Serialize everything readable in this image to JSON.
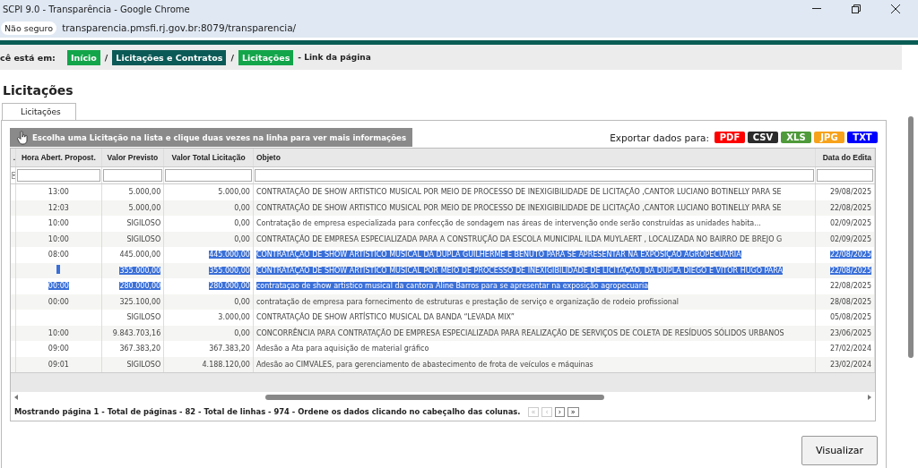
{
  "window": {
    "title": "SCPI 9.0 - Transparência - Google Chrome"
  },
  "address_bar": {
    "security": "Não seguro",
    "url": "transparencia.pmsfi.rj.gov.br:8079/transparencia/"
  },
  "breadcrumb": {
    "label": "cê está em:",
    "items": [
      {
        "text": "Início",
        "kind": "link"
      },
      {
        "text": "Licitações e Contratos",
        "kind": "section"
      },
      {
        "text": "Licitações",
        "kind": "link"
      }
    ],
    "separator": "/",
    "note": "- Link da página"
  },
  "heading": "Licitações",
  "tabs": [
    {
      "label": "Licitações",
      "selected": true
    }
  ],
  "hint": "Escolha uma Licitação na lista e clique duas vezes na linha para ver mais informações",
  "export": {
    "label": "Exportar dados para:",
    "buttons": [
      {
        "label": "PDF",
        "color": "#ff0000"
      },
      {
        "label": "CSV",
        "color": "#2b2b2b"
      },
      {
        "label": "XLS",
        "color": "#4f9a3a"
      },
      {
        "label": "JPG",
        "color": "#f7a21b"
      },
      {
        "label": "TXT",
        "color": "#0000ff"
      }
    ]
  },
  "table": {
    "cut_column": ".",
    "columns": [
      "Hora Abert. Propost.",
      "Valor Previsto",
      "Valor Total Licitação",
      "Objeto",
      "Data do Edita"
    ],
    "rows": [
      [
        {
          "text": "13:00",
          "selected": false
        },
        {
          "text": "5.000,00",
          "selected": false
        },
        {
          "text": "5.000,00",
          "selected": false
        },
        {
          "text": "CONTRATAÇÃO DE SHOW ARTISTICO MUSICAL POR MEIO DE PROCESSO DE INEXIGIBILIDADE DE LICITAÇÃO ,CANTOR LUCIANO BOTINELLY PARA SE",
          "selected": false
        },
        {
          "text": "29/08/2025",
          "selected": false
        }
      ],
      [
        {
          "text": "12:03",
          "selected": false
        },
        {
          "text": "5.000,00",
          "selected": false
        },
        {
          "text": "0,00",
          "selected": false
        },
        {
          "text": "CONTRATAÇÃO DE SHOW ARTISTICO MUSICAL POR MEIO DE PROCESSO DE INEXIGIBILIDADE DE LICITAÇÃO ,CANTOR LUCIANO BOTINELLY PARA SE",
          "selected": false
        },
        {
          "text": "22/08/2025",
          "selected": false
        }
      ],
      [
        {
          "text": "10:00",
          "selected": false
        },
        {
          "text": "SIGILOSO",
          "selected": false
        },
        {
          "text": "0,00",
          "selected": false
        },
        {
          "text": "Contratação de empresa especializada para confecção de sondagem nas áreas de intervenção onde serão construídas as unidades habita...",
          "selected": false
        },
        {
          "text": "02/09/2025",
          "selected": false
        }
      ],
      [
        {
          "text": "10:00",
          "selected": false
        },
        {
          "text": "SIGILOSO",
          "selected": false
        },
        {
          "text": "0,00",
          "selected": false
        },
        {
          "text": "CONTRATAÇÃO DE EMPRESA ESPECIALIZADA PARA A CONSTRUÇÃO DA ESCOLA MUNICIPAL ILDA MUYLAERT , LOCALIZADA NO BAIRRO DE BREJO G",
          "selected": false
        },
        {
          "text": "02/09/2025",
          "selected": false
        }
      ],
      [
        {
          "text": "08:00",
          "selected": false
        },
        {
          "text": "445.000,00",
          "selected": false
        },
        {
          "text": "445.000,00",
          "selected": true
        },
        {
          "text": "CONTRATAÇÃO DE SHOW ARTISTICO MUSICAL DA DUPLA GUILHERME E BENUTO PARA SE APRESENTAR NA EXPOSIÇÃO AGROPECUARIA",
          "selected": true
        },
        {
          "text": "22/08/2025",
          "selected": true
        }
      ],
      [
        {
          "selected": true
        },
        {
          "text": "355.000,00",
          "selected": true
        },
        {
          "text": "355.000,00",
          "selected": true
        },
        {
          "text": "CONTRATAÇÃO DE SHOW ARTISTICO MUSICAL POR MEIO DE PROCESSO DE INEXIGIBILIDADE DE LICITAÇÃO, DA DUPLA DIEGO E VITOR HUGO PARA",
          "selected": true
        },
        {
          "text": "22/08/2025",
          "selected": true
        }
      ],
      [
        {
          "text": "00:00",
          "selected": true
        },
        {
          "text": "280.000,00",
          "selected": true
        },
        {
          "text": "280.000,00",
          "selected": true
        },
        {
          "text": "contrataçao de show artistico musical da cantora Aline Barros para se apresentar na exposição agropecuaria",
          "selected": true
        },
        {
          "text": "22/08/2025",
          "selected": false
        }
      ],
      [
        {
          "text": "00:00",
          "selected": false
        },
        {
          "text": "325.100,00",
          "selected": false
        },
        {
          "text": "0,00",
          "selected": false
        },
        {
          "text": "contratação de empresa para fornecimento de estruturas e prestação de serviço e organização de rodeio profissional",
          "selected": false
        },
        {
          "text": "28/08/2025",
          "selected": false
        }
      ],
      [
        null,
        {
          "text": "SIGILOSO",
          "selected": false
        },
        {
          "text": "3.000,00",
          "selected": false
        },
        {
          "text": "CONTRATAÇÃO DE SHOW ARTÍSTICO MUSICAL DA BANDA “LEVADA MIX”",
          "selected": false
        },
        {
          "text": "05/08/2025",
          "selected": false
        }
      ],
      [
        {
          "text": "10:00",
          "selected": false
        },
        {
          "text": "9.843.703,16",
          "selected": false
        },
        {
          "text": "0,00",
          "selected": false
        },
        {
          "text": "CONCORRÊNCIA PARA CONTRATAÇÃO DE EMPRESA ESPECIALIZADA PARA REALIZAÇÃO DE SERVIÇOS DE COLETA DE RESÍDUOS SÓLIDOS URBANOS",
          "selected": false
        },
        {
          "text": "23/06/2025",
          "selected": false
        }
      ],
      [
        {
          "text": "09:00",
          "selected": false
        },
        {
          "text": "367.383,20",
          "selected": false
        },
        {
          "text": "367.383,20",
          "selected": false
        },
        {
          "text": "Adesão a Ata para aquisição de material gráfico",
          "selected": false
        },
        {
          "text": "27/02/2024",
          "selected": false
        }
      ],
      [
        {
          "text": "09:01",
          "selected": false
        },
        {
          "text": "SIGILOSO",
          "selected": false
        },
        {
          "text": "4.188.120,00",
          "selected": false
        },
        {
          "text": "Adesão ao CIMVALES, para gerenciamento de abastecimento de frota de veículos e máquinas",
          "selected": false
        },
        {
          "text": "23/02/2024",
          "selected": false
        }
      ]
    ]
  },
  "pager": {
    "text": "Mostrando página 1 - Total de páginas - 82 - Total de linhas - 974 - Ordene os dados clicando no cabeçalho das colunas.",
    "buttons": [
      {
        "label": "«",
        "disabled": true
      },
      {
        "label": "‹",
        "disabled": true
      },
      {
        "label": "›",
        "disabled": false
      },
      {
        "label": "»",
        "disabled": false
      }
    ]
  },
  "action_button": "Visualizar"
}
